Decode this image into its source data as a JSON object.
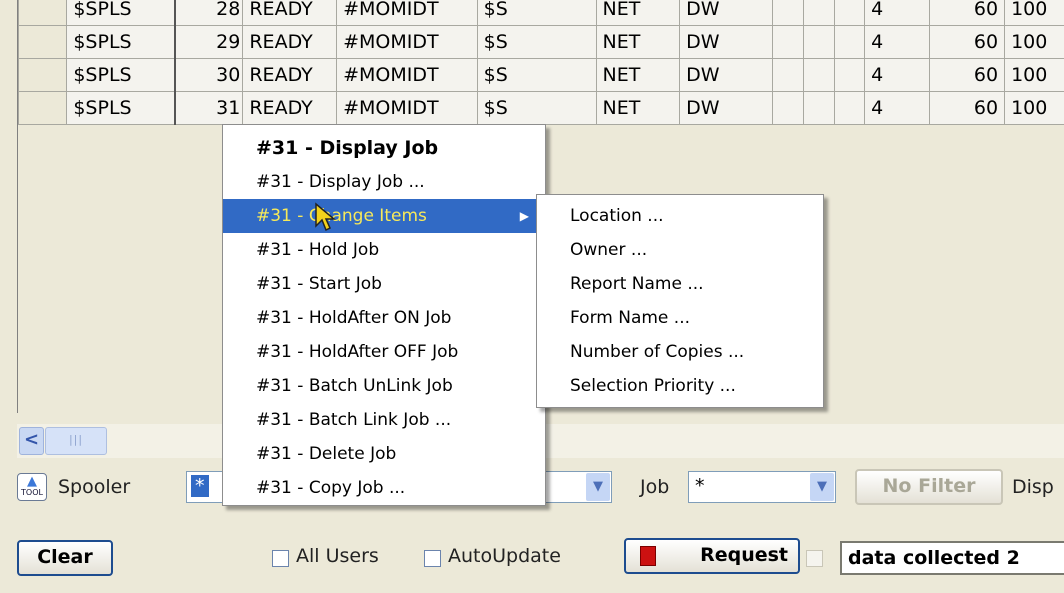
{
  "grid": {
    "rows": [
      {
        "user": "$SPLS",
        "num": "28",
        "state": "READY",
        "form": "#MOMIDT",
        "q": "$S",
        "dest": "NET",
        "dw": "DW",
        "pri": "4",
        "n60": "60",
        "n100": "100"
      },
      {
        "user": "$SPLS",
        "num": "29",
        "state": "READY",
        "form": "#MOMIDT",
        "q": "$S",
        "dest": "NET",
        "dw": "DW",
        "pri": "4",
        "n60": "60",
        "n100": "100"
      },
      {
        "user": "$SPLS",
        "num": "30",
        "state": "READY",
        "form": "#MOMIDT",
        "q": "$S",
        "dest": "NET",
        "dw": "DW",
        "pri": "4",
        "n60": "60",
        "n100": "100"
      },
      {
        "user": "$SPLS",
        "num": "31",
        "state": "READY",
        "form": "#MOMIDT",
        "q": "$S",
        "dest": "NET",
        "dw": "DW",
        "pri": "4",
        "n60": "60",
        "n100": "100"
      }
    ]
  },
  "scrollbar": {
    "left_arrow": "<",
    "thumb": "|||"
  },
  "toolbar": {
    "tool_label": "TOOL",
    "spooler_label": "Spooler",
    "spooler_value": "*",
    "job_label": "Job",
    "job_value": "*",
    "no_filter_label": "No Filter",
    "disp_label": "Disp",
    "clear_label": "Clear",
    "all_users_label": "All Users",
    "autoupdate_label": "AutoUpdate",
    "request_label": "Request",
    "status_text": "data collected 2"
  },
  "context_menu": {
    "items": [
      {
        "label": "#31 - Display Job"
      },
      {
        "label": "#31 - Display Job ..."
      },
      {
        "label": "#31 - Change Items"
      },
      {
        "label": "#31 - Hold Job"
      },
      {
        "label": "#31 - Start Job"
      },
      {
        "label": "#31 - HoldAfter ON Job"
      },
      {
        "label": "#31 - HoldAfter OFF Job"
      },
      {
        "label": "#31 - Batch UnLink Job"
      },
      {
        "label": "#31 - Batch Link Job ..."
      },
      {
        "label": "#31 - Delete Job"
      },
      {
        "label": "#31 - Copy Job ..."
      }
    ]
  },
  "submenu": {
    "items": [
      {
        "label": "Location ..."
      },
      {
        "label": "Owner ..."
      },
      {
        "label": "Report Name ..."
      },
      {
        "label": "Form Name ..."
      },
      {
        "label": "Number of Copies ..."
      },
      {
        "label": "Selection Priority ..."
      }
    ]
  },
  "colors": {
    "highlight": "#316ac5",
    "highlight_text": "#f7e95a",
    "request_icon": "#cc1111"
  }
}
